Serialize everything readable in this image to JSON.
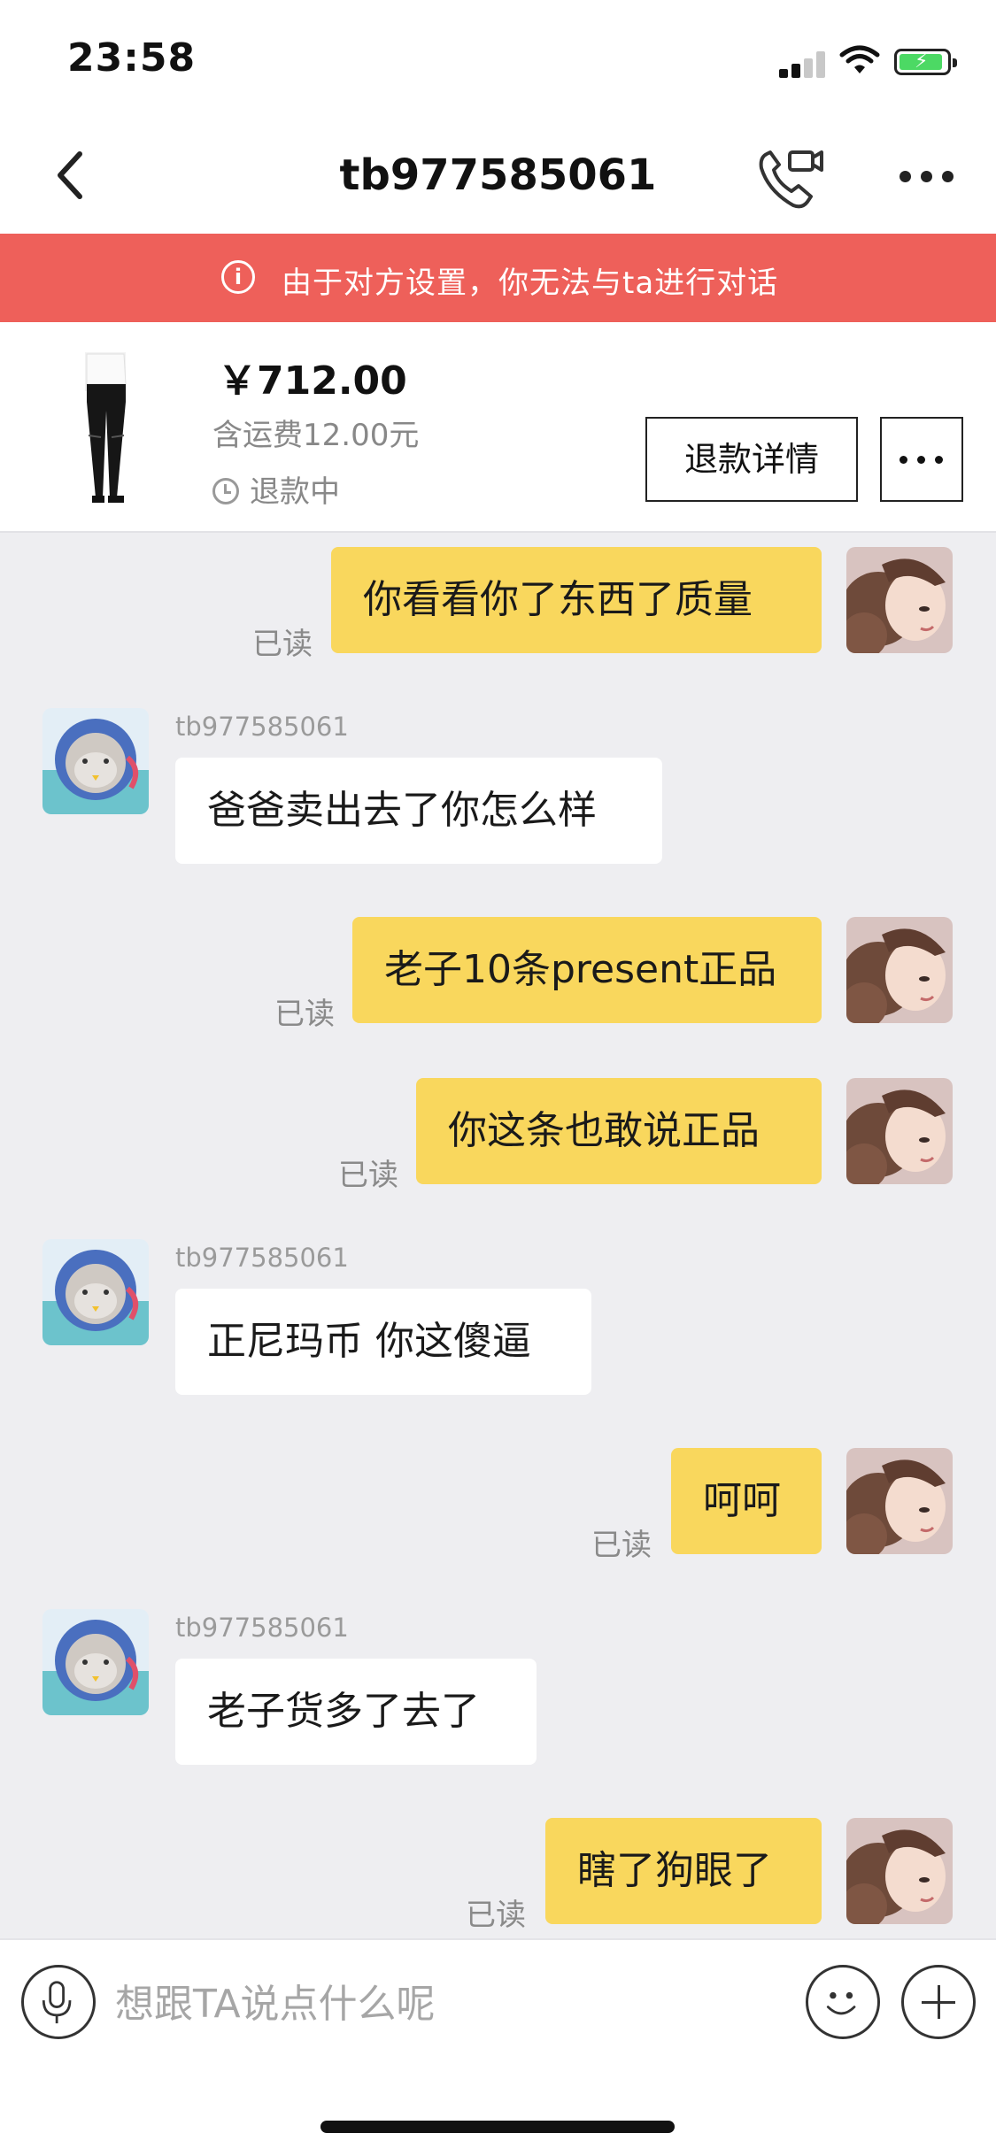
{
  "status_bar": {
    "time": "23:58"
  },
  "header": {
    "title": "tb977585061"
  },
  "banner": {
    "icon": "info-icon",
    "text": "由于对方设置，你无法与ta进行对话"
  },
  "order": {
    "price": "￥712.00",
    "shipping": "含运费12.00元",
    "status": "退款中",
    "refund_detail_label": "退款详情"
  },
  "messages": [
    {
      "from": "me",
      "text": "你看看你了东西了质量",
      "read": "已读"
    },
    {
      "from": "them",
      "sender": "tb977585061",
      "text": "爸爸卖出去了你怎么样"
    },
    {
      "from": "me",
      "text": "老子10条present正品",
      "read": "已读"
    },
    {
      "from": "me",
      "text": "你这条也敢说正品",
      "read": "已读"
    },
    {
      "from": "them",
      "sender": "tb977585061",
      "text": "正尼玛币 你这傻逼"
    },
    {
      "from": "me",
      "text": "呵呵",
      "read": "已读"
    },
    {
      "from": "them",
      "sender": "tb977585061",
      "text": "老子货多了去了"
    },
    {
      "from": "me",
      "text": "瞎了狗眼了",
      "read": "已读"
    }
  ],
  "composer": {
    "placeholder": "想跟TA说点什么呢"
  },
  "colors": {
    "banner": "#ee605a",
    "my_bubble": "#f9d75d",
    "their_bubble": "#ffffff",
    "background": "#eeeef1"
  }
}
